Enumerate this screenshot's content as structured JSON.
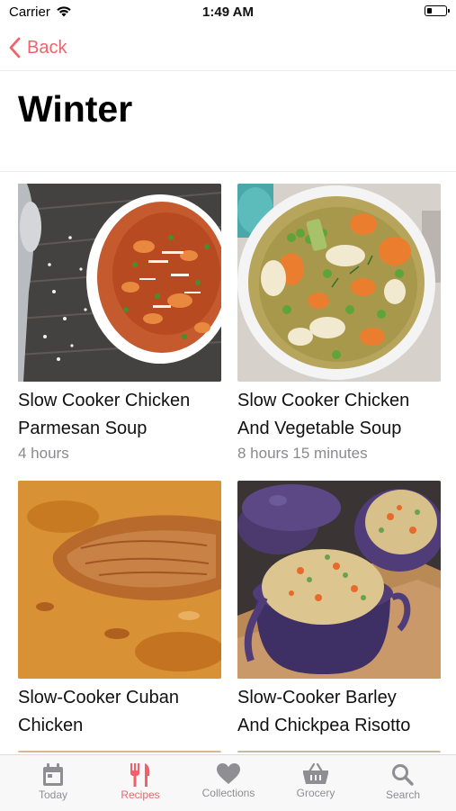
{
  "status_bar": {
    "carrier": "Carrier",
    "time": "1:49 AM"
  },
  "nav": {
    "back_label": "Back"
  },
  "page": {
    "title": "Winter"
  },
  "recipes": [
    {
      "title_line1": "Slow Cooker Chicken",
      "title_line2": "Parmesan Soup",
      "time": "4 hours"
    },
    {
      "title_line1": "Slow Cooker Chicken",
      "title_line2": "And Vegetable Soup",
      "time": "8 hours 15 minutes"
    },
    {
      "title_line1": "Slow-Cooker Cuban",
      "title_line2": "Chicken",
      "time": ""
    },
    {
      "title_line1": "Slow-Cooker Barley",
      "title_line2": "And Chickpea Risotto",
      "time": ""
    }
  ],
  "tab_bar": {
    "items": [
      {
        "label": "Today",
        "icon": "calendar-icon"
      },
      {
        "label": "Recipes",
        "icon": "fork-knife-icon"
      },
      {
        "label": "Collections",
        "icon": "heart-icon"
      },
      {
        "label": "Grocery",
        "icon": "basket-icon"
      },
      {
        "label": "Search",
        "icon": "search-icon"
      }
    ],
    "active": "Recipes"
  },
  "colors": {
    "accent": "#f2616b",
    "inactive": "#8e8e93",
    "secondary_text": "#8a8a8e"
  }
}
